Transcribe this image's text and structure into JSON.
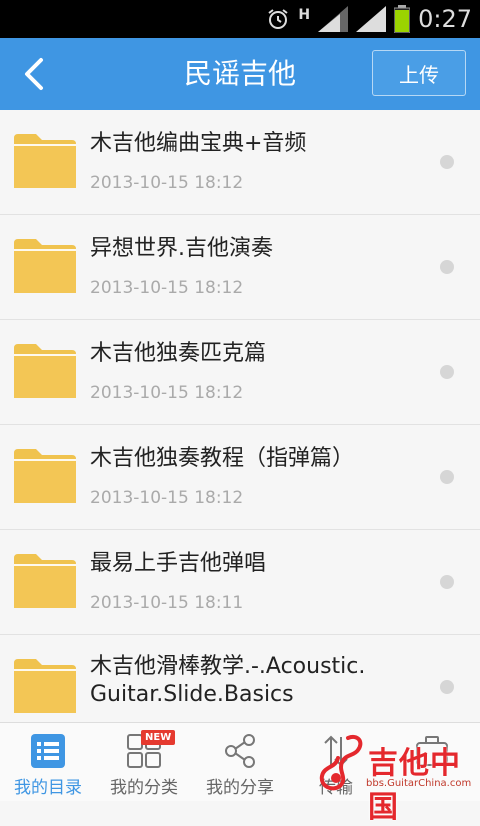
{
  "status_bar": {
    "network_label": "H",
    "time": "0:27",
    "icons": [
      "alarm-icon",
      "signal-icon",
      "signal-icon",
      "battery-icon"
    ]
  },
  "header": {
    "title": "民谣吉他",
    "upload_label": "上传",
    "back_icon": "back-chevron-icon",
    "bg_color": "#3f96e3"
  },
  "files": [
    {
      "name": "木吉他编曲宝典+音频",
      "date": "2013-10-15  18:12",
      "icon": "folder-icon"
    },
    {
      "name": "异想世界.吉他演奏",
      "date": "2013-10-15  18:12",
      "icon": "folder-icon"
    },
    {
      "name": "木吉他独奏匹克篇",
      "date": "2013-10-15  18:12",
      "icon": "folder-icon"
    },
    {
      "name": "木吉他独奏教程（指弹篇）",
      "date": "2013-10-15  18:12",
      "icon": "folder-icon"
    },
    {
      "name": "最易上手吉他弹唱",
      "date": "2013-10-15  18:11",
      "icon": "folder-icon"
    },
    {
      "name": "木吉他滑棒教学.-.Acoustic. Guitar.Slide.Basics",
      "date": "",
      "icon": "folder-icon"
    }
  ],
  "bottom_nav": {
    "tabs": [
      {
        "label": "我的目录",
        "icon": "list-icon",
        "active": true
      },
      {
        "label": "我的分类",
        "icon": "category-grid-icon",
        "badge": "NEW"
      },
      {
        "label": "我的分享",
        "icon": "share-icon"
      },
      {
        "label": "传输",
        "icon": "transfer-icon"
      },
      {
        "label": "",
        "icon": "toolbox-icon"
      }
    ],
    "accent": "#3f96e3",
    "badge_color": "#e53a2f"
  },
  "watermark": {
    "text": "吉他中国",
    "url": "bbs.GuitarChina.com"
  }
}
